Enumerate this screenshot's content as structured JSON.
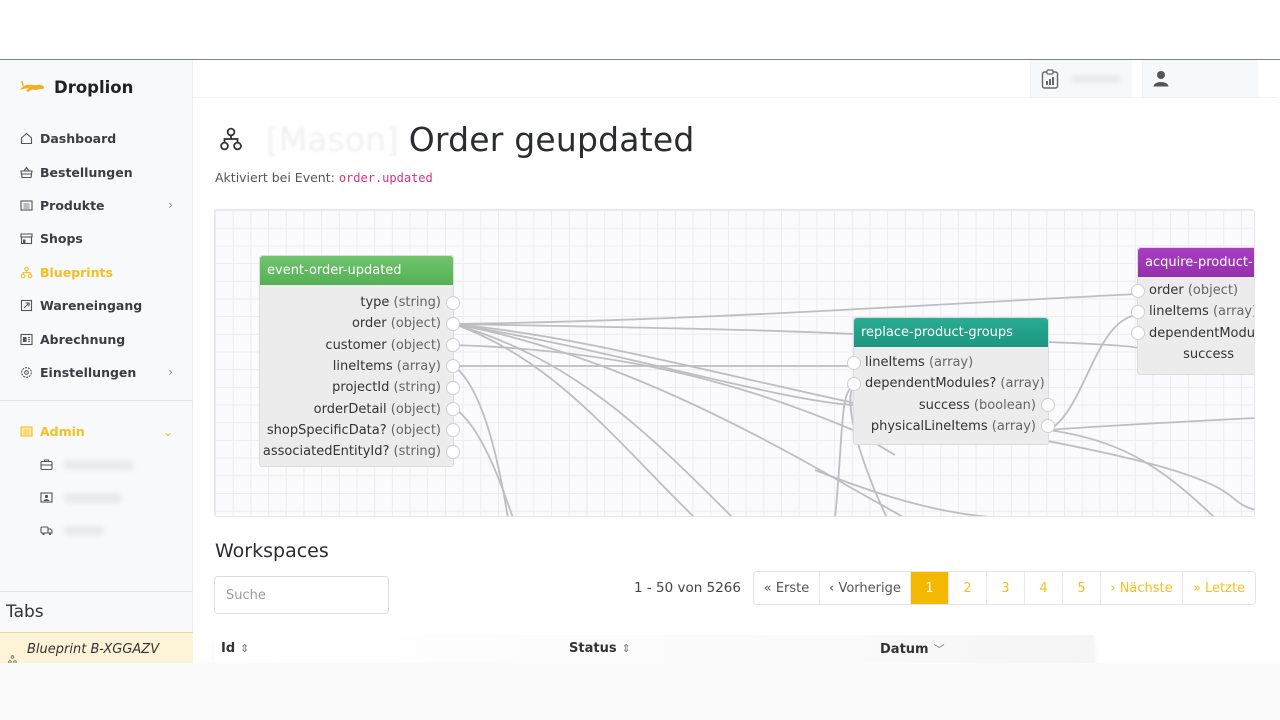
{
  "brand": {
    "name": "Droplion",
    "logo_icon": "lion-icon"
  },
  "sidebar": {
    "items": [
      {
        "label": "Dashboard",
        "icon": "home-icon",
        "has_children": false,
        "active": false
      },
      {
        "label": "Bestellungen",
        "icon": "basket-icon",
        "has_children": false,
        "active": false
      },
      {
        "label": "Produkte",
        "icon": "list-icon",
        "has_children": true,
        "active": false
      },
      {
        "label": "Shops",
        "icon": "store-icon",
        "has_children": false,
        "active": false
      },
      {
        "label": "Blueprints",
        "icon": "sitemap-icon",
        "has_children": false,
        "active": true
      },
      {
        "label": "Wareneingang",
        "icon": "inbound-icon",
        "has_children": false,
        "active": false
      },
      {
        "label": "Abrechnung",
        "icon": "invoice-icon",
        "has_children": false,
        "active": false
      },
      {
        "label": "Einstellungen",
        "icon": "gear-icon",
        "has_children": true,
        "active": false
      }
    ],
    "admin": {
      "label": "Admin",
      "icon": "list-icon",
      "expanded": true,
      "sub_items": [
        {
          "icon": "briefcase-icon"
        },
        {
          "icon": "contact-card-icon"
        },
        {
          "icon": "truck-icon"
        }
      ]
    },
    "tabs_title": "Tabs",
    "open_tab": "Blueprint B-XGGAZV"
  },
  "header": {
    "report_icon": "clipboard-chart-icon",
    "user_icon": "user-icon"
  },
  "page": {
    "title_prefix_blurred": "[Mason]",
    "title": "Order geupdated",
    "event_label": "Aktiviert bei Event:",
    "event_code": "order.updated"
  },
  "flow": {
    "nodes": [
      {
        "id": "event-order-updated",
        "title": "event-order-updated",
        "color": "#5cb85c",
        "outputs": [
          {
            "name": "type",
            "type": "(string)"
          },
          {
            "name": "order",
            "type": "(object)"
          },
          {
            "name": "customer",
            "type": "(object)"
          },
          {
            "name": "lineItems",
            "type": "(array)"
          },
          {
            "name": "projectId",
            "type": "(string)"
          },
          {
            "name": "orderDetail",
            "type": "(object)"
          },
          {
            "name": "shopSpecificData?",
            "type": "(object)"
          },
          {
            "name": "associatedEntityId?",
            "type": "(string)"
          }
        ]
      },
      {
        "id": "replace-product-groups",
        "title": "replace-product-groups",
        "color": "#20a08a",
        "inputs": [
          {
            "name": "lineItems",
            "type": "(array)"
          },
          {
            "name": "dependentModules?",
            "type": "(array)"
          }
        ],
        "outputs": [
          {
            "name": "success",
            "type": "(boolean)"
          },
          {
            "name": "physicalLineItems",
            "type": "(array)"
          }
        ]
      },
      {
        "id": "acquire-product",
        "title": "acquire-product-",
        "color": "#9c34b4",
        "inputs": [
          {
            "name": "order",
            "type": "(object)"
          },
          {
            "name": "lineItems",
            "type": "(array)"
          },
          {
            "name": "dependentModu",
            "type": ""
          }
        ],
        "outputs": [
          {
            "name": "success",
            "type": ""
          }
        ]
      }
    ]
  },
  "workspaces": {
    "title": "Workspaces",
    "search_placeholder": "Suche",
    "search_value": "",
    "range_text": "1  - 50 von 5266",
    "pagination": {
      "first": "« Erste",
      "prev": "‹ Vorherige",
      "pages": [
        "1",
        "2",
        "3",
        "4",
        "5"
      ],
      "current_page": "1",
      "next": "› Nächste",
      "last": "» Letzte"
    },
    "columns": [
      {
        "label": "Id",
        "sort": "⇕"
      },
      {
        "label": "Status",
        "sort": "⇕"
      },
      {
        "label": "Datum",
        "sort": "﹀"
      }
    ]
  }
}
